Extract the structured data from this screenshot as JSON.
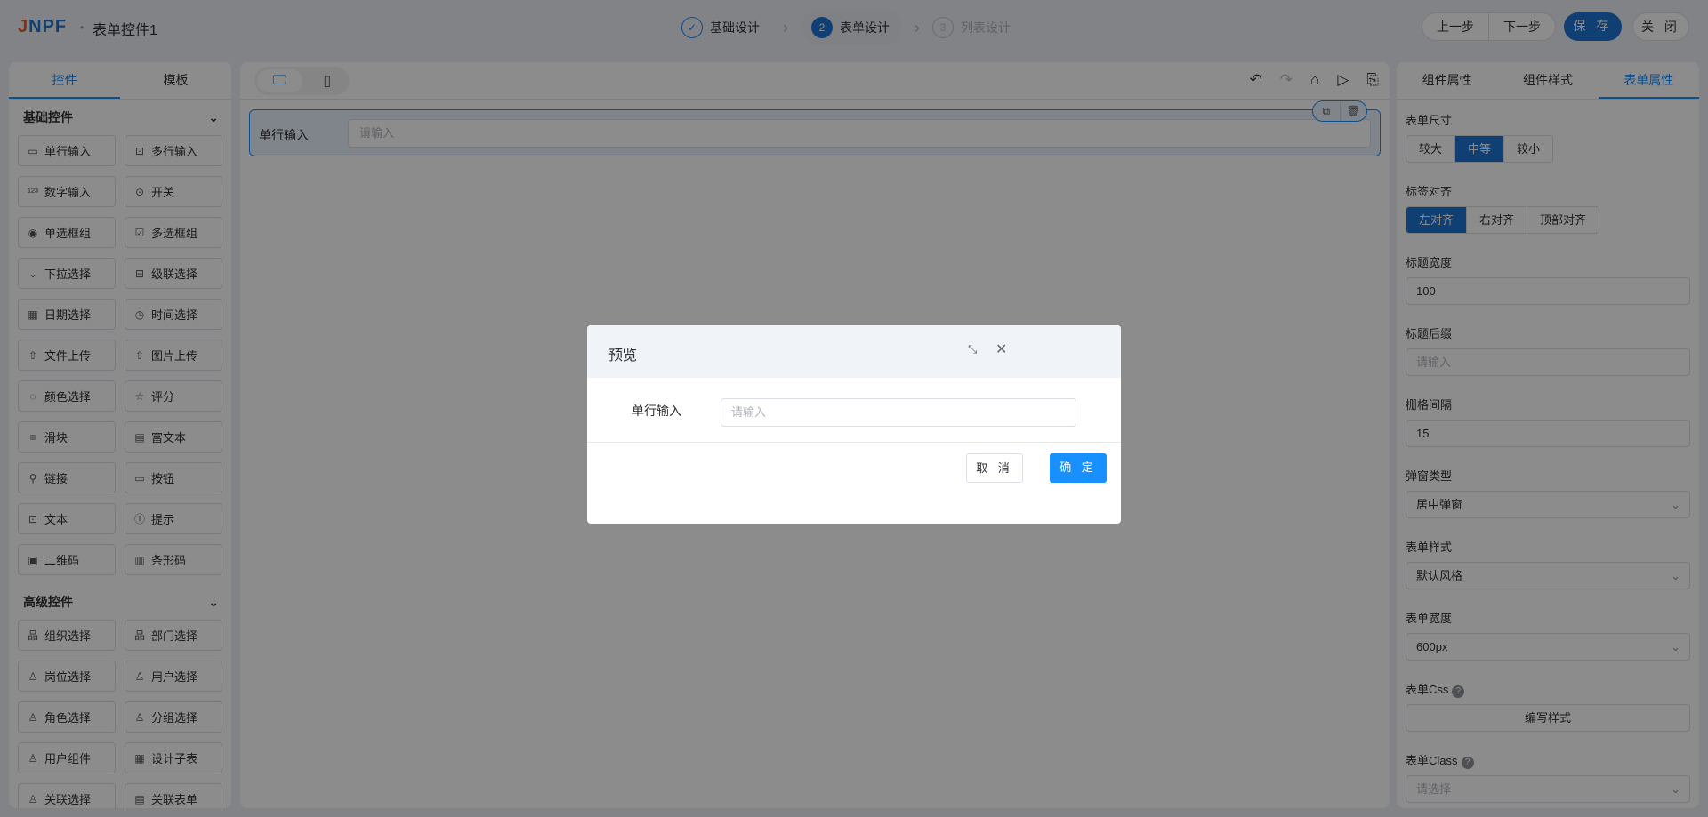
{
  "header": {
    "logo": "JNPF",
    "title": "表单控件1",
    "steps": [
      {
        "num": "✓",
        "label": "基础设计"
      },
      {
        "num": "2",
        "label": "表单设计"
      },
      {
        "num": "3",
        "label": "列表设计"
      }
    ],
    "prev": "上一步",
    "next": "下一步",
    "save": "保 存",
    "close": "关 闭"
  },
  "left": {
    "tabs": [
      "控件",
      "模板"
    ],
    "sections": [
      {
        "title": "基础控件",
        "items": [
          [
            "▭",
            "单行输入"
          ],
          [
            "⊡",
            "多行输入"
          ],
          [
            "¹²³",
            "数字输入"
          ],
          [
            "⊙",
            "开关"
          ],
          [
            "◉",
            "单选框组"
          ],
          [
            "☑",
            "多选框组"
          ],
          [
            "⌄",
            "下拉选择"
          ],
          [
            "⊟",
            "级联选择"
          ],
          [
            "▦",
            "日期选择"
          ],
          [
            "◷",
            "时间选择"
          ],
          [
            "⇧",
            "文件上传"
          ],
          [
            "⇧",
            "图片上传"
          ],
          [
            "◌",
            "颜色选择"
          ],
          [
            "☆",
            "评分"
          ],
          [
            "≡",
            "滑块"
          ],
          [
            "▤",
            "富文本"
          ],
          [
            "⚲",
            "链接"
          ],
          [
            "▭",
            "按钮"
          ],
          [
            "⊡",
            "文本"
          ],
          [
            "ⓘ",
            "提示"
          ],
          [
            "▣",
            "二维码"
          ],
          [
            "▥",
            "条形码"
          ]
        ]
      },
      {
        "title": "高级控件",
        "items": [
          [
            "品",
            "组织选择"
          ],
          [
            "品",
            "部门选择"
          ],
          [
            "♙",
            "岗位选择"
          ],
          [
            "♙",
            "用户选择"
          ],
          [
            "♙",
            "角色选择"
          ],
          [
            "♙",
            "分组选择"
          ],
          [
            "♙",
            "用户组件"
          ],
          [
            "▦",
            "设计子表"
          ],
          [
            "♙",
            "关联选择"
          ],
          [
            "▤",
            "关联表单"
          ]
        ]
      }
    ]
  },
  "canvas": {
    "field_label": "单行输入",
    "field_placeholder": "请输入",
    "tools": [
      "↶",
      "↷",
      "⌂",
      "▷",
      "⎘"
    ]
  },
  "right": {
    "tabs": [
      "组件属性",
      "组件样式",
      "表单属性"
    ],
    "size_label": "表单尺寸",
    "size_opts": [
      "较大",
      "中等",
      "较小"
    ],
    "align_label": "标签对齐",
    "align_opts": [
      "左对齐",
      "右对齐",
      "顶部对齐"
    ],
    "lw_label": "标题宽度",
    "lw_value": "100",
    "suffix_label": "标题后缀",
    "suffix_ph": "请输入",
    "gutter_label": "栅格间隔",
    "gutter_value": "15",
    "popup_label": "弹窗类型",
    "popup_value": "居中弹窗",
    "style_label": "表单样式",
    "style_value": "默认风格",
    "width_label": "表单宽度",
    "width_value": "600px",
    "css_label": "表单Css",
    "css_btn": "编写样式",
    "class_label": "表单Class",
    "class_ph": "请选择"
  },
  "modal": {
    "title": "预览",
    "field_label": "单行输入",
    "field_placeholder": "请输入",
    "cancel": "取 消",
    "ok": "确 定"
  }
}
